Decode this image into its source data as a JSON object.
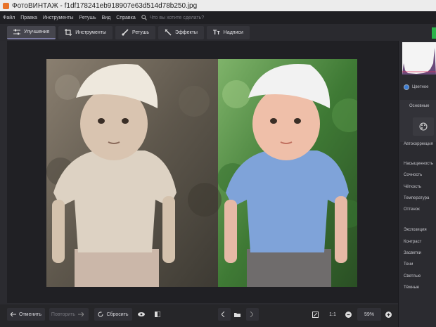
{
  "window": {
    "title": "ФотоВИНТАЖ - f1df178241eb918907e63d514d78b250.jpg"
  },
  "menu": {
    "items": [
      "Файл",
      "Правка",
      "Инструменты",
      "Ретушь",
      "Вид",
      "Справка"
    ],
    "search_placeholder": "Что вы хотите сделать?"
  },
  "toolbar": {
    "tabs": [
      {
        "label": "Улучшения",
        "icon": "sliders-icon",
        "active": true
      },
      {
        "label": "Инструменты",
        "icon": "crop-icon",
        "active": false
      },
      {
        "label": "Ретушь",
        "icon": "brush-icon",
        "active": false
      },
      {
        "label": "Эффекты",
        "icon": "magic-wand-icon",
        "active": false
      },
      {
        "label": "Надписи",
        "icon": "text-icon",
        "active": false
      }
    ]
  },
  "bottom": {
    "undo_label": "Отменить",
    "redo_label": "Повторить",
    "reset_label": "Сбросить",
    "ratio_label": "1:1",
    "zoom_value": "59%"
  },
  "panel": {
    "mode_label": "Цветное",
    "section_label": "Основные",
    "auto_label": "Автокоррекция",
    "color_params": [
      "Насыщенность",
      "Сочность",
      "Чёткость",
      "Температура",
      "Оттенок"
    ],
    "light_params": [
      "Экспозиция",
      "Контраст",
      "Засветки",
      "Тени",
      "Светлые",
      "Тёмные"
    ]
  },
  "colors": {
    "accent_green": "#2bb34a",
    "active_tab_bg": "#45454d",
    "app_icon": "#e8732a"
  }
}
